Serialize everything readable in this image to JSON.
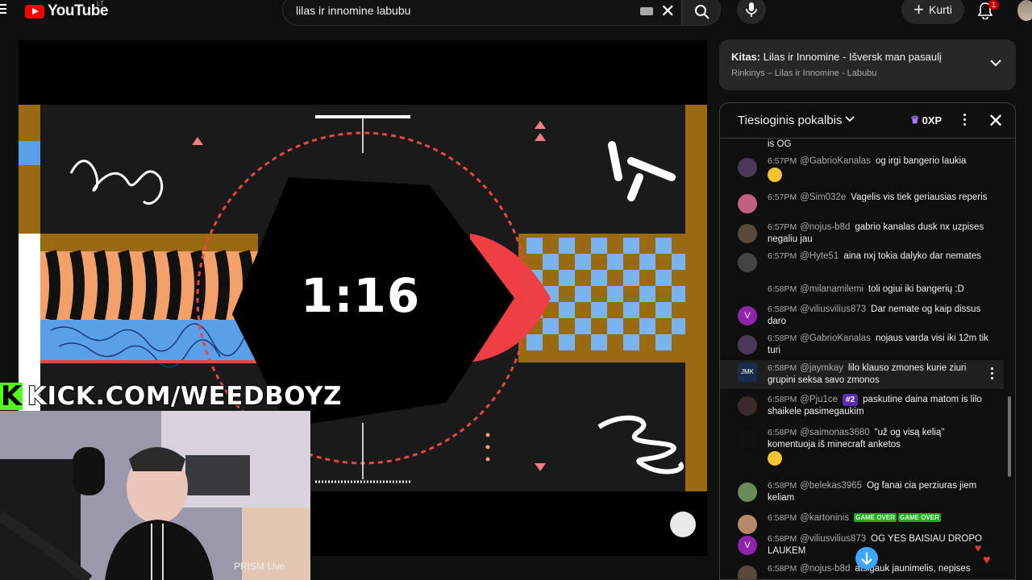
{
  "header": {
    "logo_text": "YouTube",
    "logo_region": "LT",
    "search_value": "lilas ir innomine labubu",
    "create_label": "Kurti",
    "notifications_count": "1"
  },
  "player": {
    "timer_text": "1:16",
    "kick_text": "KICK.COM/WEEDBOYZ",
    "prism_label": "PRISM Live"
  },
  "next_card": {
    "prefix": "Kitas:",
    "title": "Lilas ir Innomine - Išversk man pasaulį",
    "subtitle": "Rinkinys – Lilas ir Innomine - Labubu"
  },
  "chat": {
    "title": "Tiesioginis pokalbis",
    "xp": "0XP",
    "messages": [
      {
        "time": "",
        "author": "",
        "text": "is OG"
      },
      {
        "time": "6:57PM",
        "author": "@GabrioKanalas",
        "text": "og irgi bangerio laukia"
      },
      {
        "time": "6:57PM",
        "author": "@Sim032e",
        "text": "Vagelis vis tiek geriausias reperis"
      },
      {
        "time": "6:57PM",
        "author": "@nojus-b8d",
        "text": "gabrio kanalas dusk nx uzpises negaliu jau"
      },
      {
        "time": "6:57PM",
        "author": "@Hyte51",
        "text": "aina nxj tokia dalyko dar nemates"
      },
      {
        "time": "6:58PM",
        "author": "@milanamilemi",
        "text": "toli ogiui iki bangerių :D"
      },
      {
        "time": "6:58PM",
        "author": "@viliusvilius873",
        "text": "Dar nemate og kaip dissus daro"
      },
      {
        "time": "6:58PM",
        "author": "@GabrioKanalas",
        "text": "nojaus varda visi iki 12m tik turi"
      },
      {
        "time": "6:58PM",
        "author": "@jaymkay",
        "text": "lilo klauso zmones kurie ziuri grupini seksa savo zmonos"
      },
      {
        "time": "6:58PM",
        "author": "@Pju1ce",
        "badge": "#2",
        "text": "paskutine daina matom is lilo shaikele pasimegaukim"
      },
      {
        "time": "6:58PM",
        "author": "@saimonas3680",
        "text": "\"už og visą kelią\" komentuoja iš minecraft anketos"
      },
      {
        "time": "6:58PM",
        "author": "@belekas3965",
        "text": "Og fanai cia perziuras jiem keliam"
      },
      {
        "time": "6:58PM",
        "author": "@kartoninis",
        "text": ""
      },
      {
        "time": "6:58PM",
        "author": "@viliusvilius873",
        "text": "OG YES BAISIAU DROPO LAUKEM"
      },
      {
        "time": "6:58PM",
        "author": "@nojus-b8d",
        "text": "atsigauk jaunimelis, nepises"
      }
    ],
    "avatar_letters": {
      "v": "V",
      "jmk": "JMK"
    },
    "gameover_label": "GAME OVER"
  },
  "colors": {
    "accent_red": "#ff0000",
    "kick_green": "#53fc18",
    "badge_purple": "#5b2fb5",
    "scroll_blue": "#3ea6ff"
  }
}
